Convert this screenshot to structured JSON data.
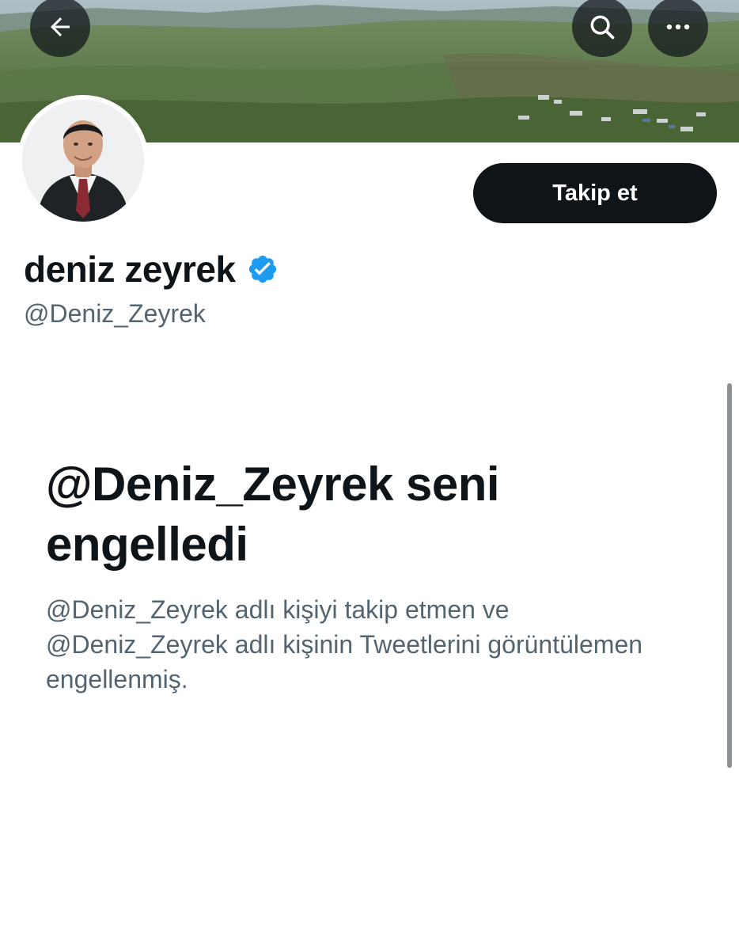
{
  "header": {
    "back_icon": "arrow-left-icon",
    "search_icon": "search-icon",
    "more_icon": "more-horizontal-icon"
  },
  "profile": {
    "display_name": "deniz zeyrek",
    "handle": "@Deniz_Zeyrek",
    "verified": true,
    "follow_label": "Takip et"
  },
  "blocked": {
    "title": "@Deniz_Zeyrek seni engelledi",
    "description": "@Deniz_Zeyrek adlı kişiyi takip etmen ve @Deniz_Zeyrek adlı kişinin Tweetlerini görüntülemen engellenmiş."
  },
  "colors": {
    "primary_text": "#0f1419",
    "secondary_text": "#536471",
    "verified_blue": "#1d9bf0",
    "button_bg": "#0f1419"
  }
}
